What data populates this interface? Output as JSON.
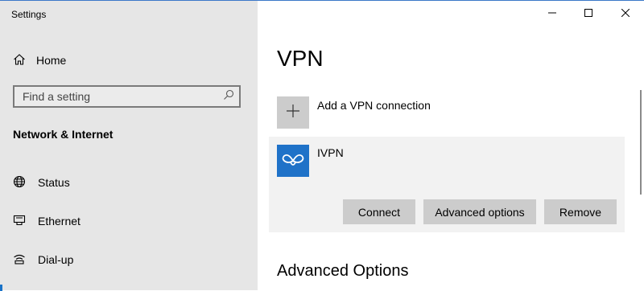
{
  "window": {
    "title": "Settings",
    "minimize_icon": "minimize-icon",
    "maximize_icon": "maximize-icon",
    "close_icon": "close-icon"
  },
  "sidebar": {
    "home": {
      "label": "Home",
      "icon": "home-icon"
    },
    "search": {
      "value": "",
      "placeholder": "Find a setting",
      "icon": "search-icon"
    },
    "section_title": "Network & Internet",
    "items": [
      {
        "label": "Status",
        "icon": "globe-icon"
      },
      {
        "label": "Ethernet",
        "icon": "ethernet-icon"
      },
      {
        "label": "Dial-up",
        "icon": "dialup-icon"
      }
    ]
  },
  "main": {
    "title": "VPN",
    "add_vpn_label": "Add a VPN connection",
    "add_vpn_icon": "plus-icon",
    "connection": {
      "name": "IVPN",
      "icon": "ivpn-logo-icon",
      "buttons": {
        "connect": "Connect",
        "advanced": "Advanced options",
        "remove": "Remove"
      }
    },
    "advanced_heading": "Advanced Options"
  },
  "colors": {
    "sidebar_bg": "#e6e6e6",
    "card_bg": "#f2f2f2",
    "button_bg": "#cccccc",
    "accent": "#1f72c8"
  }
}
